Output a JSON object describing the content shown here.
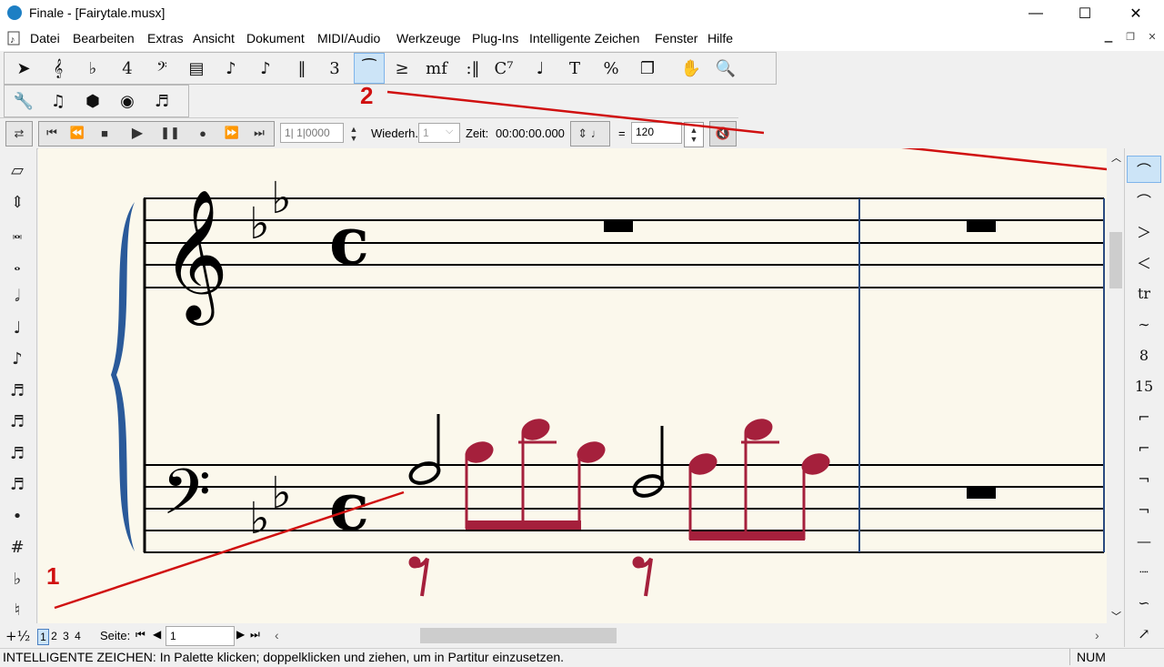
{
  "window": {
    "app": "Finale",
    "title": "Finale  - [Fairytale.musx]",
    "minimize": "—",
    "maximize": "☐",
    "close": "✕"
  },
  "menu": [
    "Datei",
    "Bearbeiten",
    "Extras",
    "Ansicht",
    "Dokument",
    "MIDI/Audio",
    "Werkzeuge",
    "Plug-Ins",
    "Intelligente Zeichen",
    "Fenster",
    "Hilfe"
  ],
  "main_tools": [
    {
      "name": "selection-tool",
      "glyph": "➤"
    },
    {
      "name": "staff-tool",
      "glyph": "𝄞"
    },
    {
      "name": "key-signature-tool",
      "glyph": "♭"
    },
    {
      "name": "time-signature-tool",
      "glyph": "4"
    },
    {
      "name": "clef-tool",
      "glyph": "𝄢"
    },
    {
      "name": "measure-tool",
      "glyph": "▤"
    },
    {
      "name": "simple-entry-tool",
      "glyph": "♪"
    },
    {
      "name": "speedy-entry-tool",
      "glyph": "♪"
    },
    {
      "name": "hyperscribe-tool",
      "glyph": "‖"
    },
    {
      "name": "tuplet-tool",
      "glyph": "3"
    },
    {
      "name": "smart-shape-tool",
      "glyph": "⁀"
    },
    {
      "name": "articulation-tool",
      "glyph": "≥"
    },
    {
      "name": "expression-tool",
      "glyph": "mf"
    },
    {
      "name": "repeat-tool",
      "glyph": ":‖"
    },
    {
      "name": "chord-tool",
      "glyph": "C⁷"
    },
    {
      "name": "lyrics-tool",
      "glyph": "♩"
    },
    {
      "name": "text-tool",
      "glyph": "T"
    },
    {
      "name": "resize-tool",
      "glyph": "%"
    },
    {
      "name": "page-layout-tool",
      "glyph": "❐"
    },
    {
      "name": "hand-grabber-tool",
      "glyph": "✋"
    },
    {
      "name": "zoom-tool",
      "glyph": "🔍"
    }
  ],
  "second_tools": [
    {
      "name": "utilities-tool",
      "glyph": "🔧"
    },
    {
      "name": "mixer-tool",
      "glyph": "♫"
    },
    {
      "name": "studio-tool",
      "glyph": "⬢"
    },
    {
      "name": "audio-tool",
      "glyph": "◉"
    },
    {
      "name": "midi-tool",
      "glyph": "♬"
    }
  ],
  "playback": {
    "position": "1| 1|0000",
    "repeat_label": "Wiederh.",
    "repeat_value": "1",
    "time_label": "Zeit:",
    "time_value": "00:00:00.000",
    "equals": "=",
    "tempo": "120"
  },
  "left_palette": [
    "▱",
    "⇕",
    "𝅜",
    "𝅝",
    "𝅗𝅥",
    "♩",
    "♪",
    "♬",
    "♬",
    "♬",
    "♬",
    "•",
    "#",
    "♭",
    "♮",
    "+½"
  ],
  "right_palette": [
    "⌒",
    "⌒",
    "＞",
    "＜",
    "tr",
    "∼",
    "8",
    "15",
    "⌐",
    "⌐",
    "¬",
    "¬",
    "—",
    "┈",
    "∽",
    "↗"
  ],
  "score": {
    "annotation_1": "1",
    "annotation_2": "2"
  },
  "pages": {
    "label": "Seite:",
    "tabs": [
      "1",
      "2",
      "3",
      "4"
    ],
    "current": "1"
  },
  "status": {
    "text": "INTELLIGENTE ZEICHEN: In Palette klicken; doppelklicken und ziehen, um in Partitur einzusetzen.",
    "num": "NUM"
  },
  "colors": {
    "accent_note": "#a5203c",
    "barline": "#2a4a80",
    "annotation": "#d01010",
    "paper": "#fbf8ec"
  }
}
